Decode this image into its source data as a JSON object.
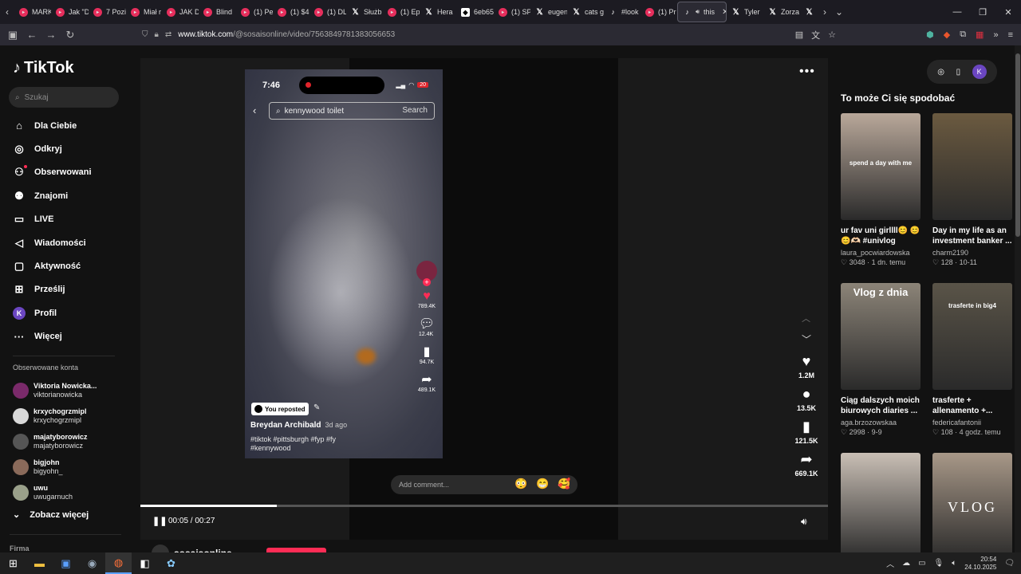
{
  "browser": {
    "tabs": [
      {
        "label": "MARK",
        "icon": "youtube-icon"
      },
      {
        "label": "Jak \"D",
        "icon": "youtube-icon"
      },
      {
        "label": "7 Pozi",
        "icon": "youtube-icon"
      },
      {
        "label": "Miał r",
        "icon": "youtube-icon"
      },
      {
        "label": "JAK D",
        "icon": "youtube-icon"
      },
      {
        "label": "Blind",
        "icon": "youtube-icon"
      },
      {
        "label": "(1) Pe",
        "icon": "youtube-icon"
      },
      {
        "label": "(1) $4",
        "icon": "youtube-icon"
      },
      {
        "label": "(1) DL",
        "icon": "youtube-icon"
      },
      {
        "label": "Służb",
        "icon": "x-icon"
      },
      {
        "label": "(1) Ep",
        "icon": "youtube-icon"
      },
      {
        "label": "Hera",
        "icon": "x-icon"
      },
      {
        "label": "6eb65",
        "icon": "github-icon"
      },
      {
        "label": "(1) SP",
        "icon": "youtube-icon"
      },
      {
        "label": "eugen",
        "icon": "x-icon"
      },
      {
        "label": "cats g",
        "icon": "x-icon"
      },
      {
        "label": "#look",
        "icon": "tiktok-icon"
      },
      {
        "label": "(1) Pr",
        "icon": "youtube-icon"
      },
      {
        "label": "this",
        "icon": "tiktok-icon",
        "active": true
      },
      {
        "label": "Tyler",
        "icon": "x-icon"
      },
      {
        "label": "Zorza",
        "icon": "x-icon"
      },
      {
        "label": "",
        "icon": "x-icon"
      }
    ],
    "url_host": "www.tiktok.com",
    "url_path": "/@sosaisonline/video/7563849781383056653"
  },
  "sidebar": {
    "logo": "TikTok",
    "search_placeholder": "Szukaj",
    "nav": [
      {
        "label": "Dla Ciebie",
        "icon": "home-icon"
      },
      {
        "label": "Odkryj",
        "icon": "compass-icon"
      },
      {
        "label": "Obserwowani",
        "icon": "following-icon"
      },
      {
        "label": "Znajomi",
        "icon": "friends-icon"
      },
      {
        "label": "LIVE",
        "icon": "live-icon"
      },
      {
        "label": "Wiadomości",
        "icon": "messages-icon"
      },
      {
        "label": "Aktywność",
        "icon": "activity-icon"
      },
      {
        "label": "Prześlij",
        "icon": "upload-icon"
      },
      {
        "label": "Profil",
        "icon": "profile-avatar"
      },
      {
        "label": "Więcej",
        "icon": "more-icon"
      }
    ],
    "profile_initial": "K",
    "following_title": "Obserwowane konta",
    "following": [
      {
        "name": "Viktoria Nowicka...",
        "handle": "viktorianowicka",
        "color": "#7a2a6a"
      },
      {
        "name": "krxychogrzmipl",
        "handle": "krxychogrzmipl",
        "color": "#d8d8d8"
      },
      {
        "name": "majatyborowicz",
        "handle": "majatyborowicz",
        "color": "#555555"
      },
      {
        "name": "bigjohn",
        "handle": "bigyohn_",
        "color": "#8a6a5a"
      },
      {
        "name": "uwu",
        "handle": "uwugarnuch",
        "color": "#9aa08a"
      }
    ],
    "see_more": "Zobacz więcej",
    "footer": "Firma"
  },
  "video": {
    "phone_time": "7:46",
    "phone_battery": "20",
    "phone_search_text": "kennywood toilet",
    "phone_search_button": "Search",
    "phone_like_count": "789.4K",
    "phone_comment_count": "12.4K",
    "phone_save_count": "94.7K",
    "phone_share_count": "489.1K",
    "reposted_label": "You reposted",
    "author": "Breydan Archibald",
    "author_time": "3d ago",
    "tags": "#tiktok #pittsburgh #fyp #fy #kennywood",
    "comment_placeholder": "Add comment...",
    "emojis": [
      "😳",
      "😁",
      "🥰"
    ],
    "likes": "1.2M",
    "comments": "13.5K",
    "saves": "121.5K",
    "shares": "669.1K",
    "time": "00:05 / 00:27",
    "progress": 0.198,
    "uploader": "sosaisonline"
  },
  "recommendations": {
    "title": "To może Ci się spodobać",
    "cards": [
      {
        "title": "ur fav uni girllll😊 😊 😊🫶🏻 #univlog",
        "user": "laura_pocwiardowska",
        "stat": "♡ 3048 · 1 dn. temu",
        "overlay": "spend a day with me",
        "bg": "#b9a89a"
      },
      {
        "title": "Day in my life as an investment banker ...",
        "user": "charm2190",
        "stat": "♡ 128 · 10-11",
        "overlay": "",
        "bg": "#6b5a40"
      },
      {
        "title": "Ciąg dalszych moich biurowych diaries ...",
        "user": "aga.brzozowskaa",
        "stat": "♡ 2998 · 9-9",
        "overlay": "Vlog z dnia",
        "bg": "#8c8478"
      },
      {
        "title": "trasferte + allenamento +...",
        "user": "federicafantonii",
        "stat": "♡ 108 · 4 godz. temu",
        "overlay": "trasferte in big4",
        "bg": "#5a5448"
      },
      {
        "title": "",
        "user": "",
        "stat": "",
        "overlay": "",
        "bg": "#c9bfb5"
      },
      {
        "title": "",
        "user": "",
        "stat": "",
        "overlay": "VLOG",
        "bg": "#a89888"
      }
    ]
  },
  "taskbar": {
    "time": "20:54",
    "date": "24.10.2025"
  }
}
